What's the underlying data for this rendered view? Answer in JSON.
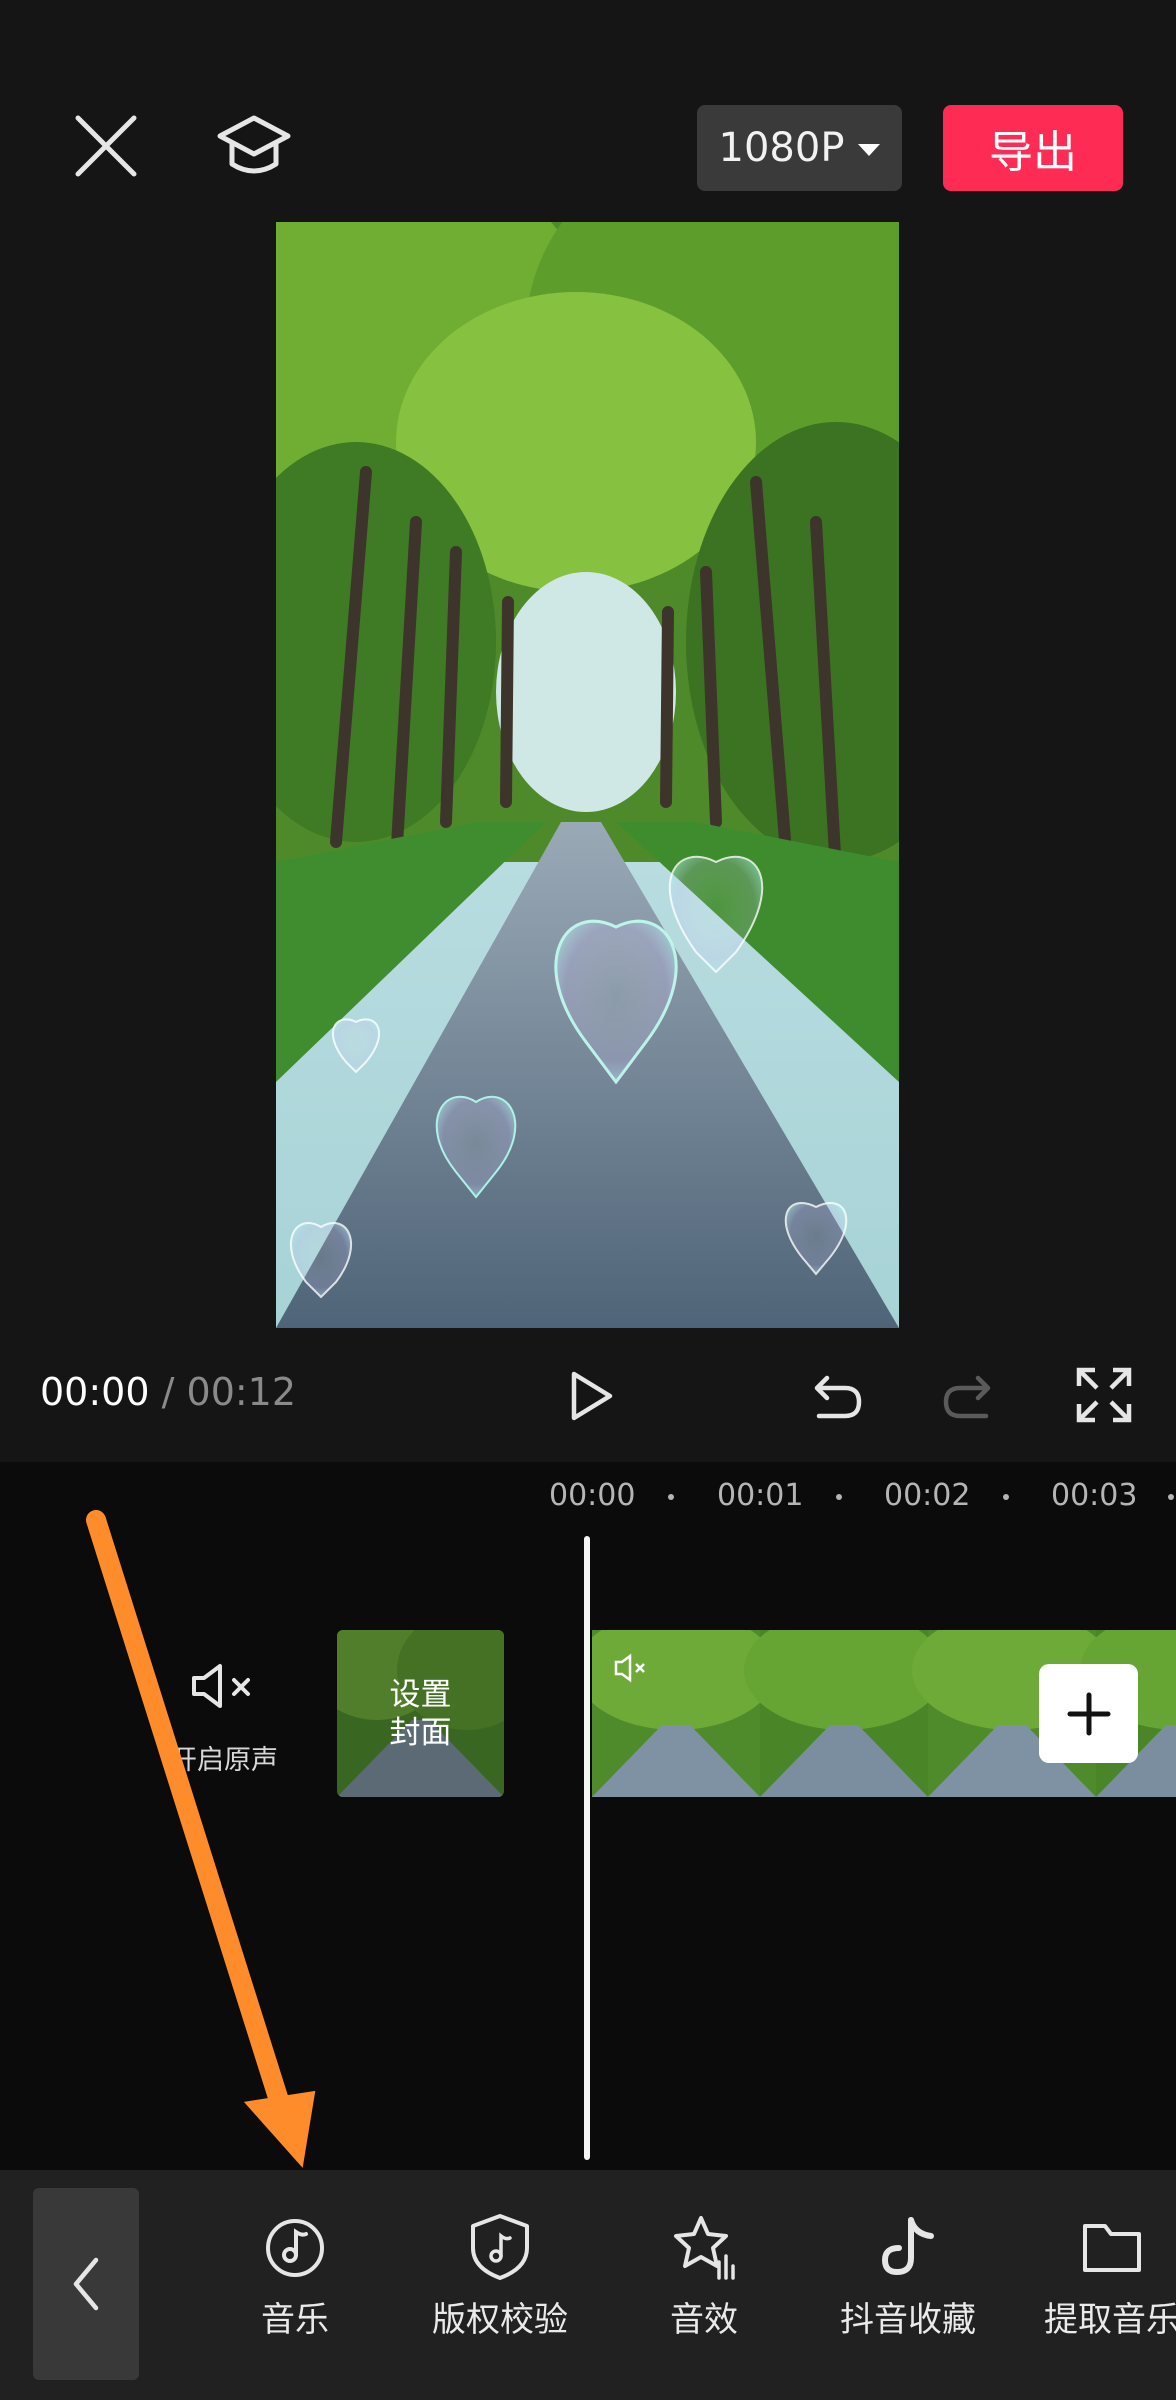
{
  "header": {
    "resolution_label": "1080P",
    "export_label": "导出"
  },
  "playback": {
    "current_time": "00:00",
    "separator": "/",
    "total_time": "00:12"
  },
  "timeline": {
    "ticks": [
      "00:00",
      "00:01",
      "00:02",
      "00:03"
    ],
    "mute_label": "开启原声",
    "cover_line1": "设置",
    "cover_line2": "封面"
  },
  "toolbar": {
    "items": [
      {
        "label": "音乐",
        "icon": "music-disc-icon"
      },
      {
        "label": "版权校验",
        "icon": "shield-music-icon"
      },
      {
        "label": "音效",
        "icon": "star-sound-icon"
      },
      {
        "label": "抖音收藏",
        "icon": "douyin-icon"
      },
      {
        "label": "提取音乐",
        "icon": "folder-icon"
      }
    ]
  },
  "colors": {
    "accent": "#fe2c55",
    "annotation_arrow": "#ff8c2a",
    "background": "#151515"
  }
}
